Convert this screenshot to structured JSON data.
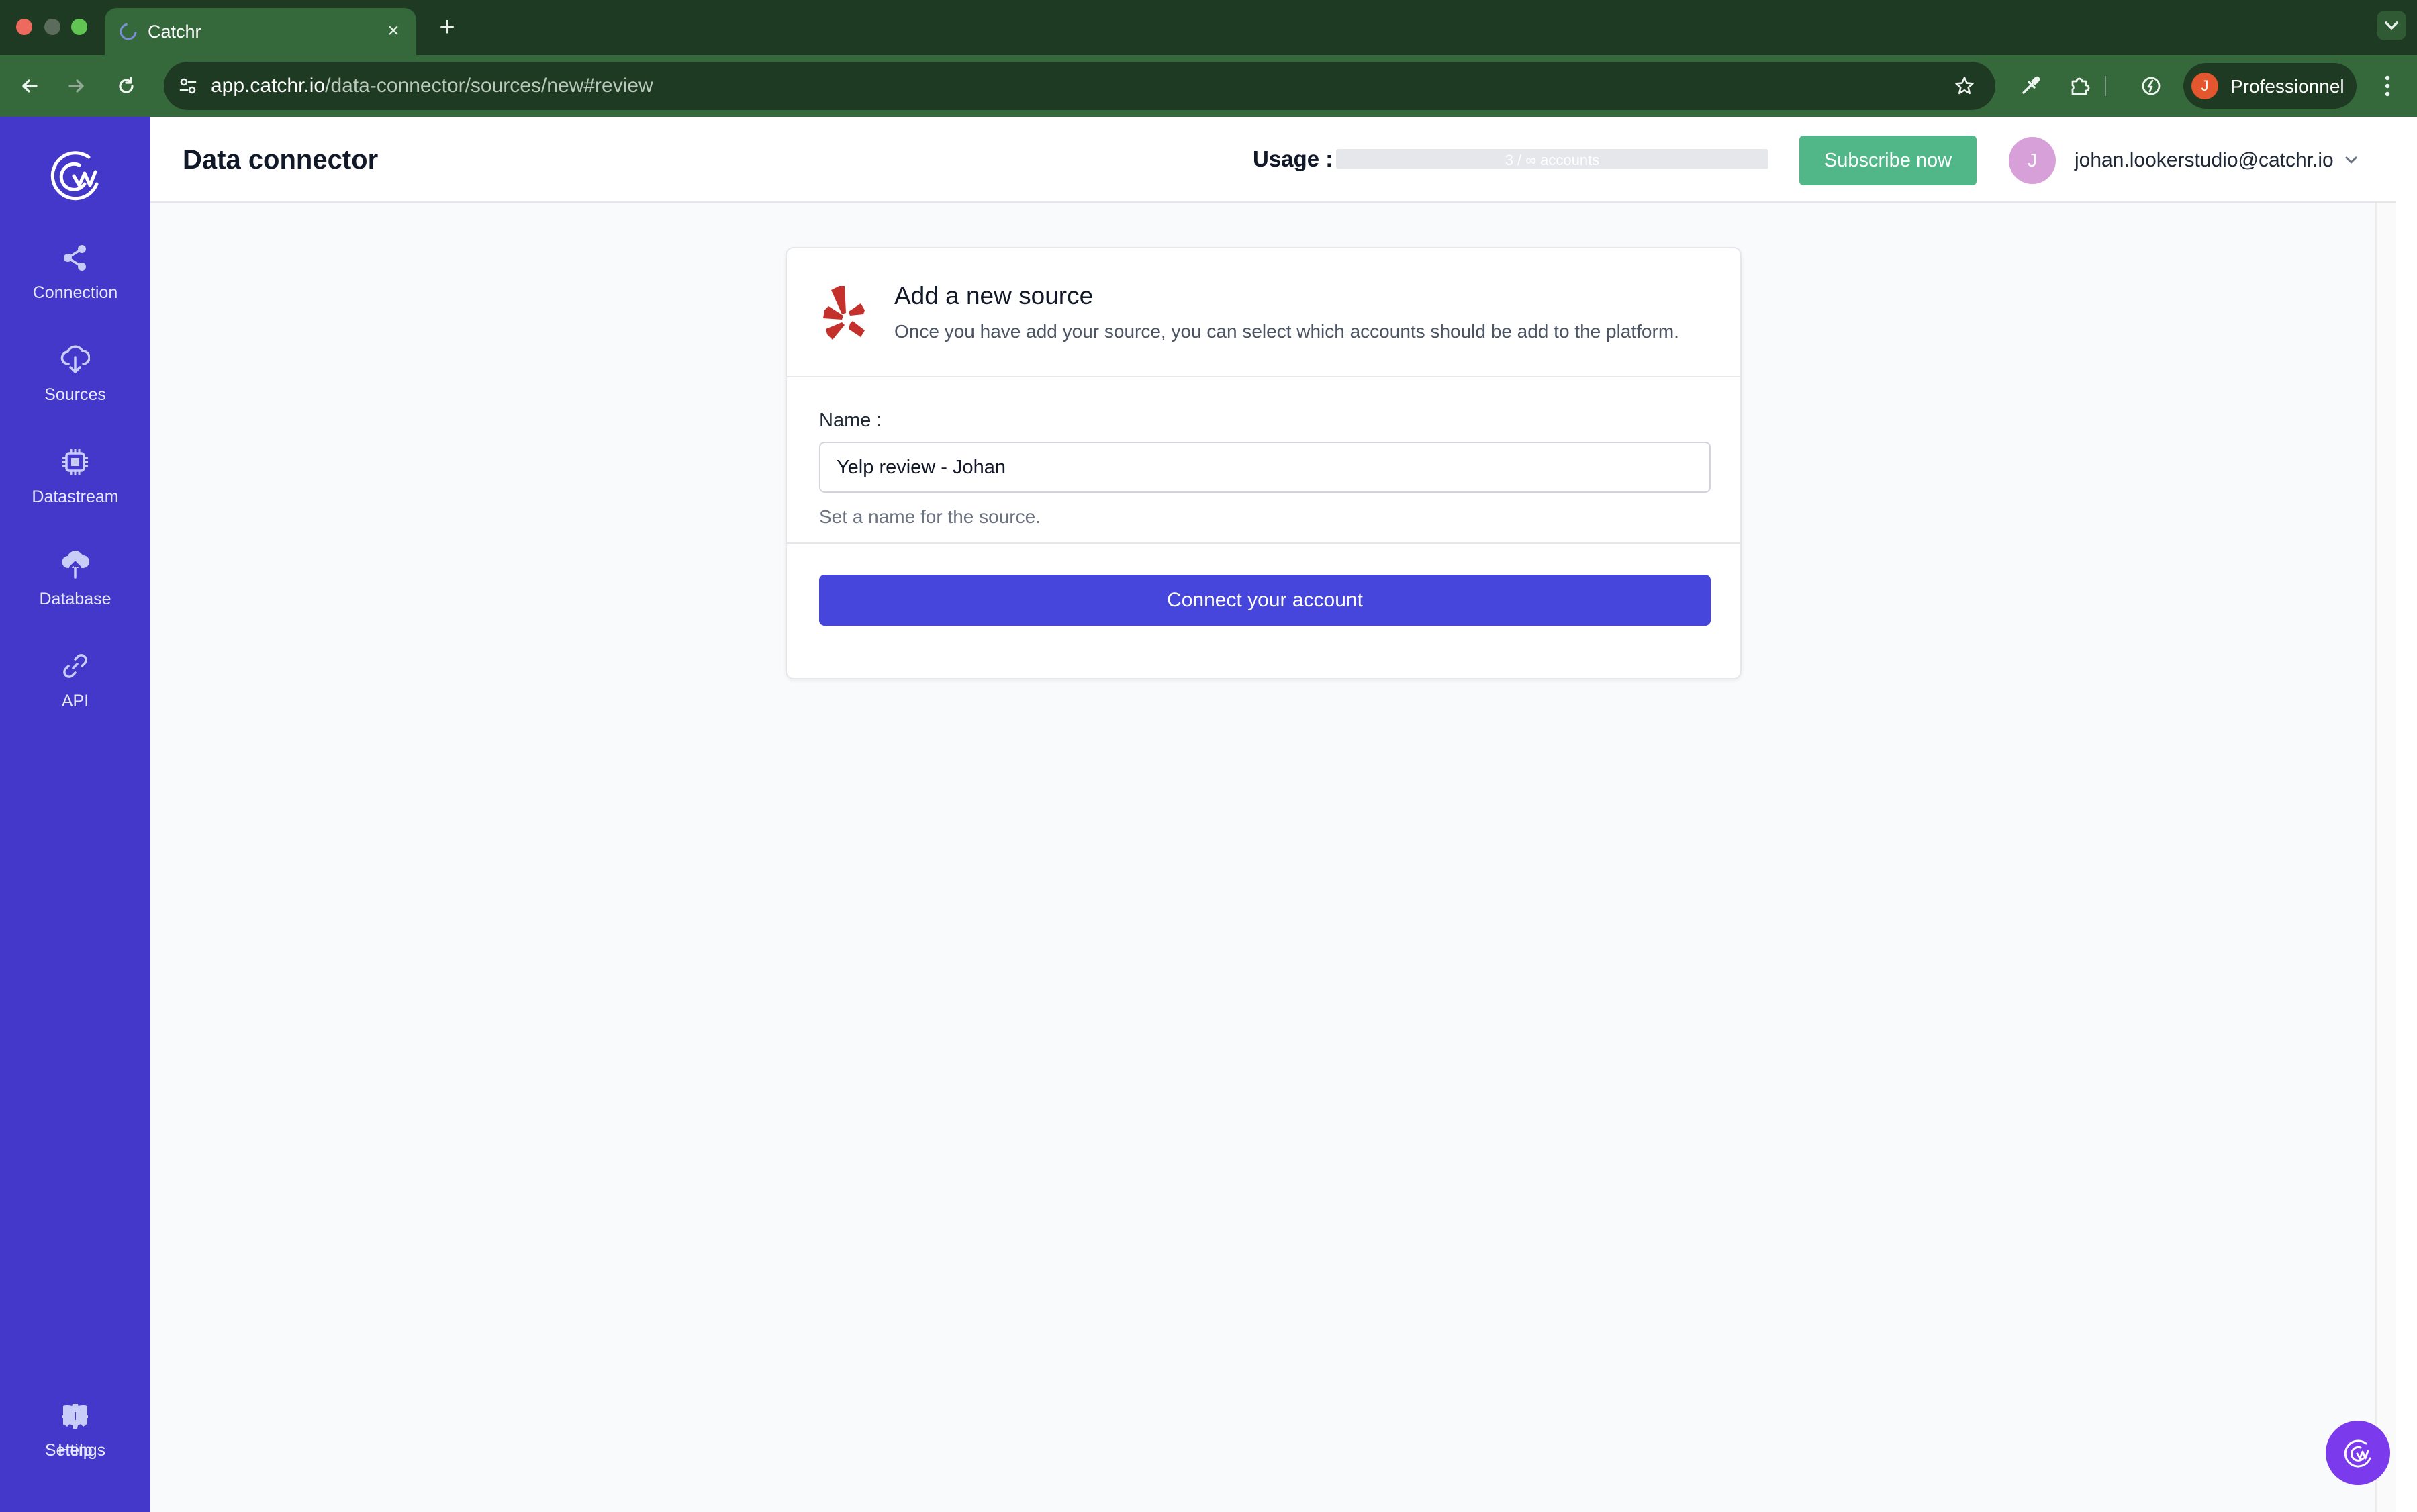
{
  "browser": {
    "tab_title": "Catchr",
    "tab_close": "×",
    "new_tab": "+",
    "url_host": "app.catchr.io",
    "url_path": "/data-connector/sources/new#review",
    "profile_initial": "J",
    "profile_name": "Professionnel"
  },
  "colors": {
    "browser_frame": "#1f3a22",
    "browser_toolbar": "#35693b",
    "sidebar": "#4338ca",
    "subscribe": "#52b788",
    "primary_button": "#4646dc",
    "yelp_red": "#c4302b",
    "chat_fab": "#7c3aed"
  },
  "sidebar": {
    "logo_icon": "catchr-logo-icon",
    "items": [
      {
        "label": "Connection",
        "icon": "share-icon"
      },
      {
        "label": "Sources",
        "icon": "cloud-download-icon"
      },
      {
        "label": "Datastream",
        "icon": "chip-icon"
      },
      {
        "label": "Database",
        "icon": "cloud-upload-icon"
      },
      {
        "label": "API",
        "icon": "link-icon"
      }
    ],
    "bottom_items": [
      {
        "label": "Settings",
        "icon": "gear-icon"
      },
      {
        "label": "Help",
        "icon": "book-icon"
      }
    ]
  },
  "header": {
    "title": "Data connector",
    "usage_label": "Usage :",
    "usage_text": "3 / ∞ accounts",
    "subscribe_label": "Subscribe now",
    "user_initial": "J",
    "user_email": "johan.lookerstudio@catchr.io"
  },
  "card": {
    "source_icon": "yelp-icon",
    "title": "Add a new source",
    "subtitle": "Once you have add your source, you can select which accounts should be add to the platform.",
    "name_label": "Name :",
    "name_value": "Yelp review - Johan",
    "name_help": "Set a name for the source.",
    "connect_label": "Connect your account"
  }
}
